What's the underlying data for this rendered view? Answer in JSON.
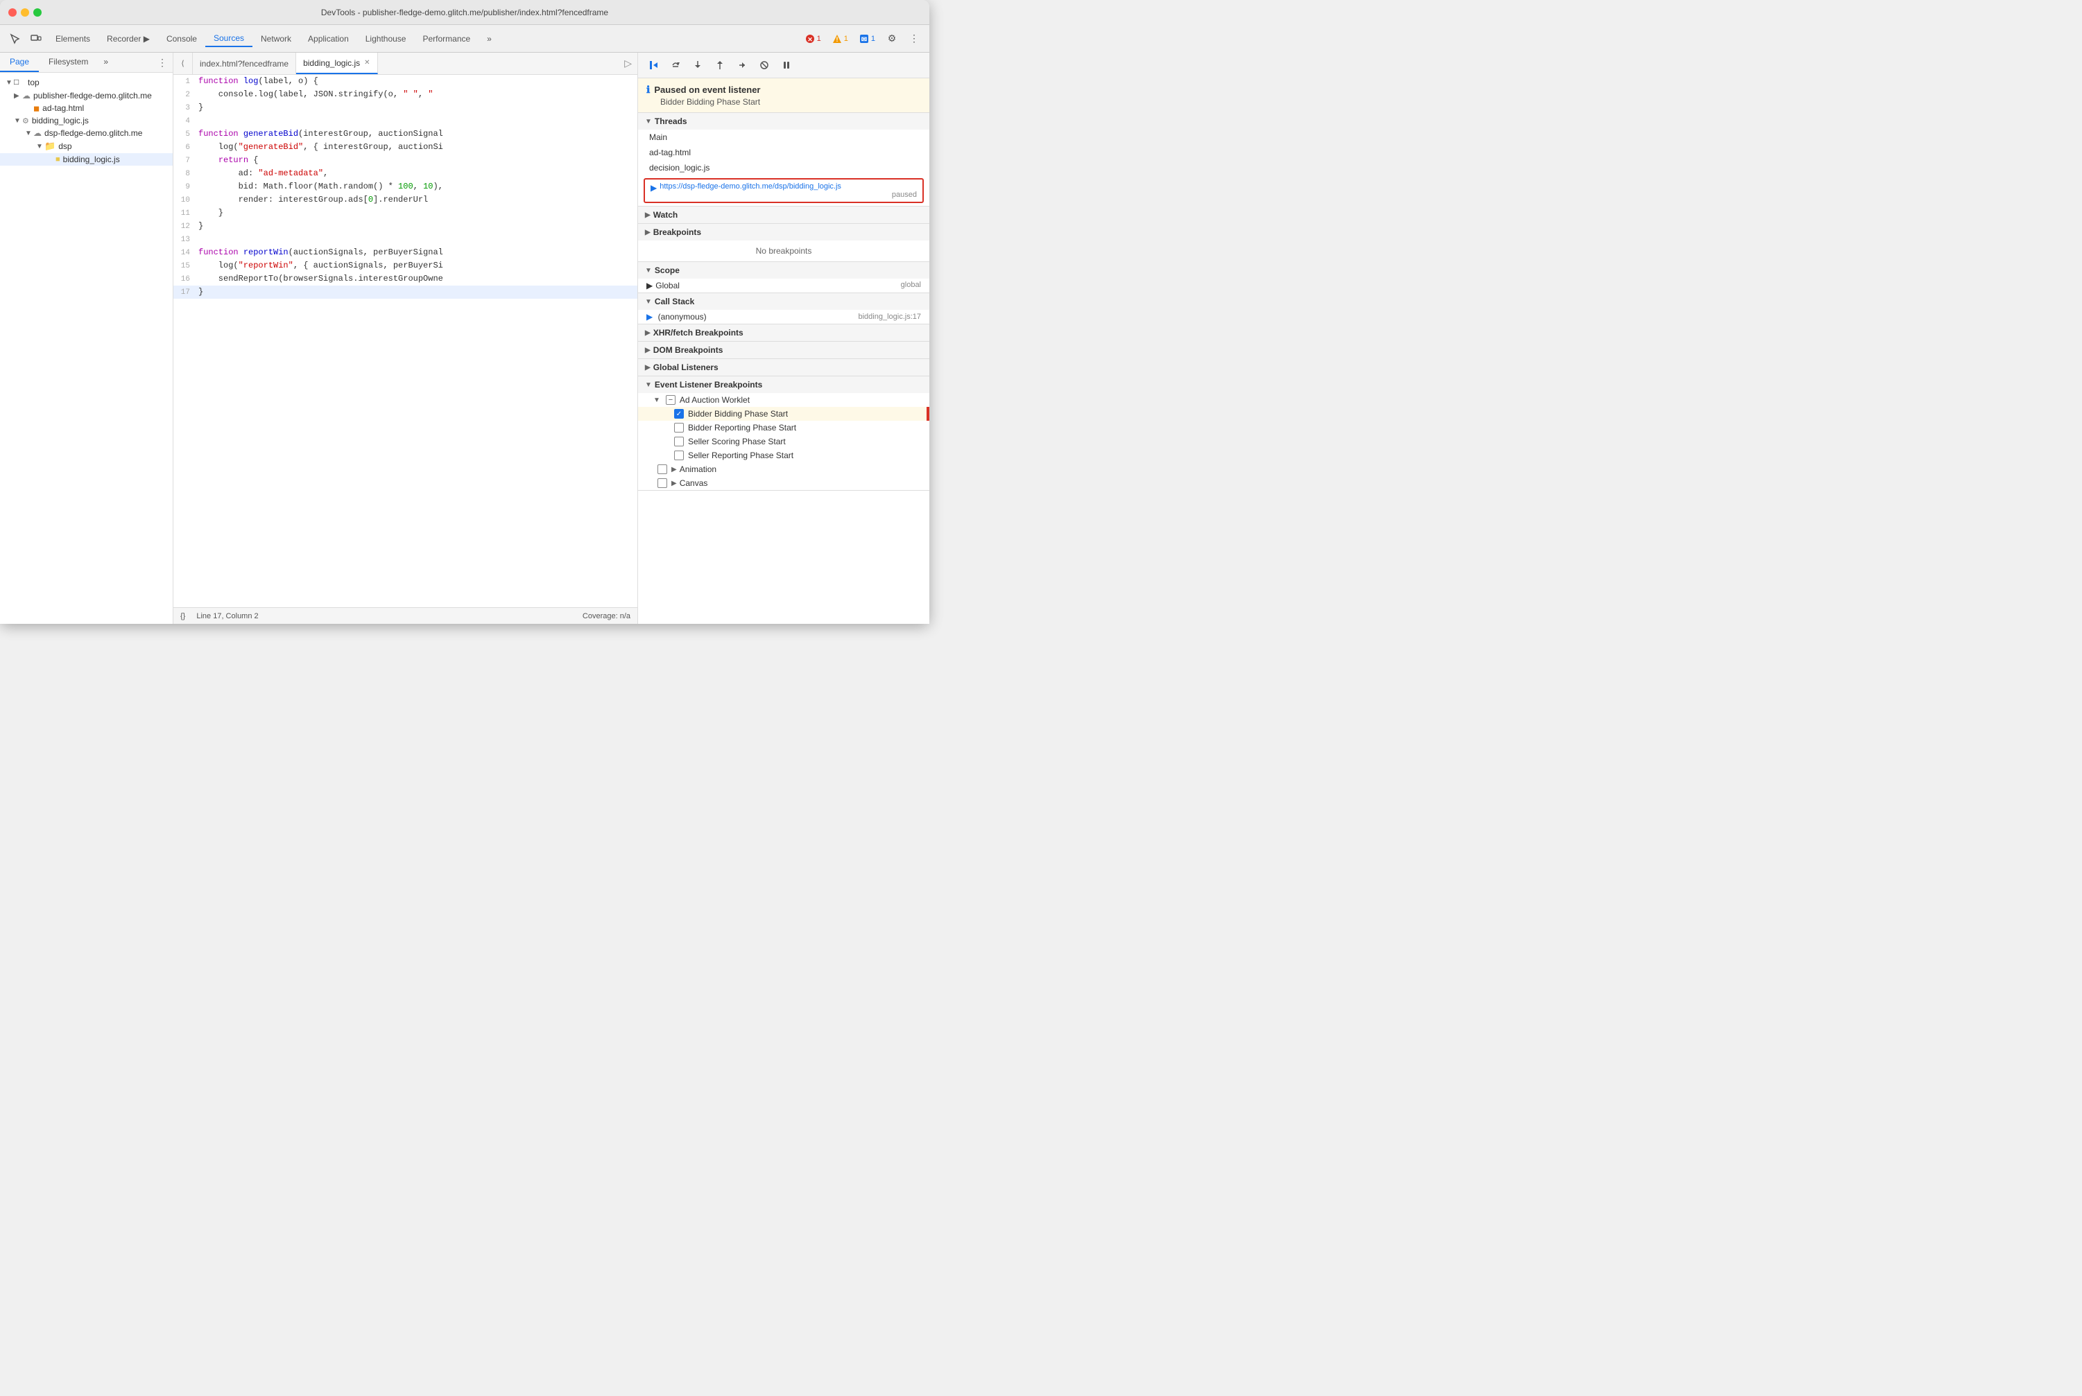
{
  "titleBar": {
    "title": "DevTools - publisher-fledge-demo.glitch.me/publisher/index.html?fencedframe"
  },
  "toolbar": {
    "tabs": [
      {
        "label": "Elements",
        "active": false
      },
      {
        "label": "Recorder ▶",
        "active": false
      },
      {
        "label": "Console",
        "active": false
      },
      {
        "label": "Sources",
        "active": true
      },
      {
        "label": "Network",
        "active": false
      },
      {
        "label": "Application",
        "active": false
      },
      {
        "label": "Lighthouse",
        "active": false
      },
      {
        "label": "Performance",
        "active": false
      },
      {
        "label": "»",
        "active": false
      }
    ],
    "badges": {
      "error": "1",
      "warning": "1",
      "info": "1"
    }
  },
  "fileTree": {
    "tabs": [
      "Page",
      "Filesystem",
      "»"
    ],
    "activeTab": "Page",
    "items": [
      {
        "label": "top",
        "level": 0,
        "type": "folder",
        "expanded": true
      },
      {
        "label": "publisher-fledge-demo.glitch.me",
        "level": 1,
        "type": "domain",
        "expanded": false
      },
      {
        "label": "ad-tag.html",
        "level": 2,
        "type": "html"
      },
      {
        "label": "bidding_logic.js",
        "level": 1,
        "type": "js-gear",
        "expanded": true
      },
      {
        "label": "dsp-fledge-demo.glitch.me",
        "level": 2,
        "type": "domain",
        "expanded": true
      },
      {
        "label": "dsp",
        "level": 3,
        "type": "folder",
        "expanded": true
      },
      {
        "label": "bidding_logic.js",
        "level": 4,
        "type": "js-file",
        "selected": true
      }
    ]
  },
  "editorTabs": [
    {
      "label": "index.html?fencedframe",
      "active": false,
      "closable": false
    },
    {
      "label": "bidding_logic.js",
      "active": true,
      "closable": true
    }
  ],
  "code": {
    "lines": [
      {
        "num": 1,
        "content": "function log(label, o) {"
      },
      {
        "num": 2,
        "content": "    console.log(label, JSON.stringify(o, \" \", \""
      },
      {
        "num": 3,
        "content": "}"
      },
      {
        "num": 4,
        "content": ""
      },
      {
        "num": 5,
        "content": "function generateBid(interestGroup, auctionSignal"
      },
      {
        "num": 6,
        "content": "    log(\"generateBid\", { interestGroup, auctionSi"
      },
      {
        "num": 7,
        "content": "    return {"
      },
      {
        "num": 8,
        "content": "        ad: \"ad-metadata\","
      },
      {
        "num": 9,
        "content": "        bid: Math.floor(Math.random() * 100, 10),"
      },
      {
        "num": 10,
        "content": "        render: interestGroup.ads[0].renderUrl"
      },
      {
        "num": 11,
        "content": "    }"
      },
      {
        "num": 12,
        "content": "}"
      },
      {
        "num": 13,
        "content": ""
      },
      {
        "num": 14,
        "content": "function reportWin(auctionSignals, perBuyerSignal"
      },
      {
        "num": 15,
        "content": "    log(\"reportWin\", { auctionSignals, perBuyerSi"
      },
      {
        "num": 16,
        "content": "    sendReportTo(browserSignals.interestGroupOwne"
      },
      {
        "num": 17,
        "content": "}",
        "highlighted": true
      }
    ]
  },
  "statusBar": {
    "curlyBraces": "{}",
    "position": "Line 17, Column 2",
    "coverage": "Coverage: n/a"
  },
  "debugPanel": {
    "pausedNotice": {
      "title": "Paused on event listener",
      "subtitle": "Bidder Bidding Phase Start"
    },
    "threads": {
      "label": "Threads",
      "items": [
        {
          "label": "Main"
        },
        {
          "label": "ad-tag.html"
        },
        {
          "label": "decision_logic.js"
        },
        {
          "label": "https://dsp-fledge-demo.glitch.me/dsp/bidding_logic.js",
          "status": "paused",
          "active": true
        }
      ]
    },
    "watch": {
      "label": "Watch"
    },
    "breakpoints": {
      "label": "Breakpoints",
      "content": "No breakpoints"
    },
    "scope": {
      "label": "Scope",
      "items": [
        {
          "label": "▶ Global",
          "value": "global"
        }
      ]
    },
    "callStack": {
      "label": "Call Stack",
      "items": [
        {
          "name": "(anonymous)",
          "location": "bidding_logic.js:17"
        }
      ]
    },
    "xhrBreakpoints": {
      "label": "XHR/fetch Breakpoints"
    },
    "domBreakpoints": {
      "label": "DOM Breakpoints"
    },
    "globalListeners": {
      "label": "Global Listeners"
    },
    "eventListenerBreakpoints": {
      "label": "Event Listener Breakpoints",
      "sections": [
        {
          "label": "Ad Auction Worklet",
          "expanded": true,
          "items": [
            {
              "label": "Bidder Bidding Phase Start",
              "checked": true,
              "highlighted": true
            },
            {
              "label": "Bidder Reporting Phase Start",
              "checked": false
            },
            {
              "label": "Seller Scoring Phase Start",
              "checked": false
            },
            {
              "label": "Seller Reporting Phase Start",
              "checked": false
            }
          ]
        },
        {
          "label": "Animation",
          "expanded": false,
          "items": []
        },
        {
          "label": "Canvas",
          "expanded": false,
          "items": []
        }
      ]
    }
  }
}
